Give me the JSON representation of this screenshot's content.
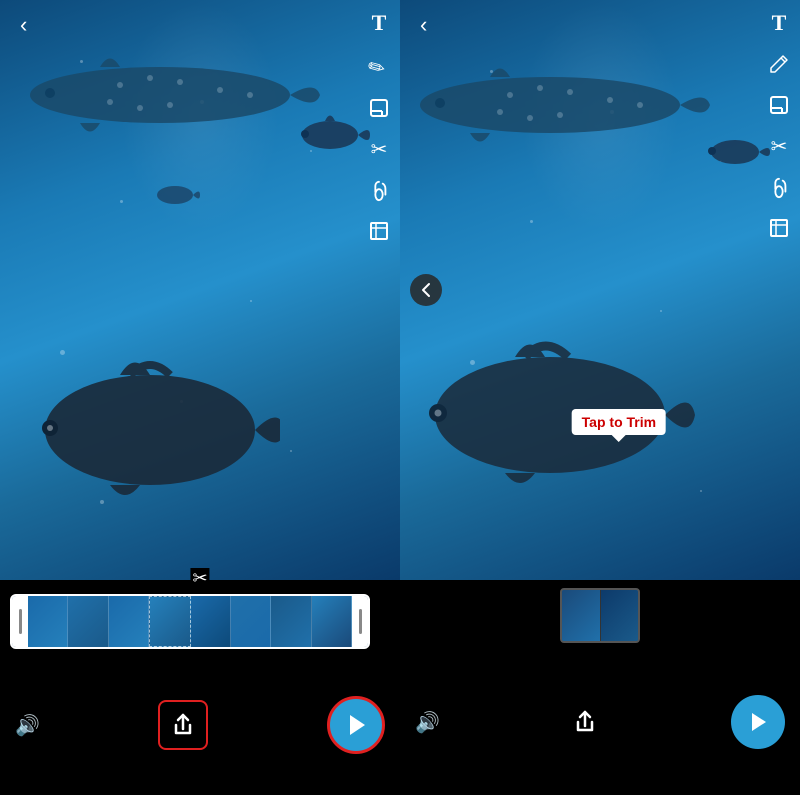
{
  "left_panel": {
    "back_label": "‹",
    "toolbar": {
      "text_icon": "T",
      "edit_icon": "✎",
      "sticker_icon": "⊟",
      "scissors_icon": "✂",
      "link_icon": "⊘",
      "crop_icon": "⊡"
    },
    "trim_strip": {
      "scissors_top": "✂"
    },
    "bottom": {
      "volume_icon": "🔊",
      "share_label": "↑",
      "play_label": "▶"
    }
  },
  "right_panel": {
    "back_label": "‹",
    "toolbar": {
      "text_icon": "T",
      "edit_icon": "✎",
      "sticker_icon": "⊟",
      "scissors_icon": "✂",
      "link_icon": "⊘",
      "crop_icon": "⊡"
    },
    "chevron_left": "‹",
    "tap_to_trim_label": "Tap to Trim",
    "bottom": {
      "volume_icon": "🔊",
      "share_label": "↑",
      "play_label": "▶"
    }
  }
}
